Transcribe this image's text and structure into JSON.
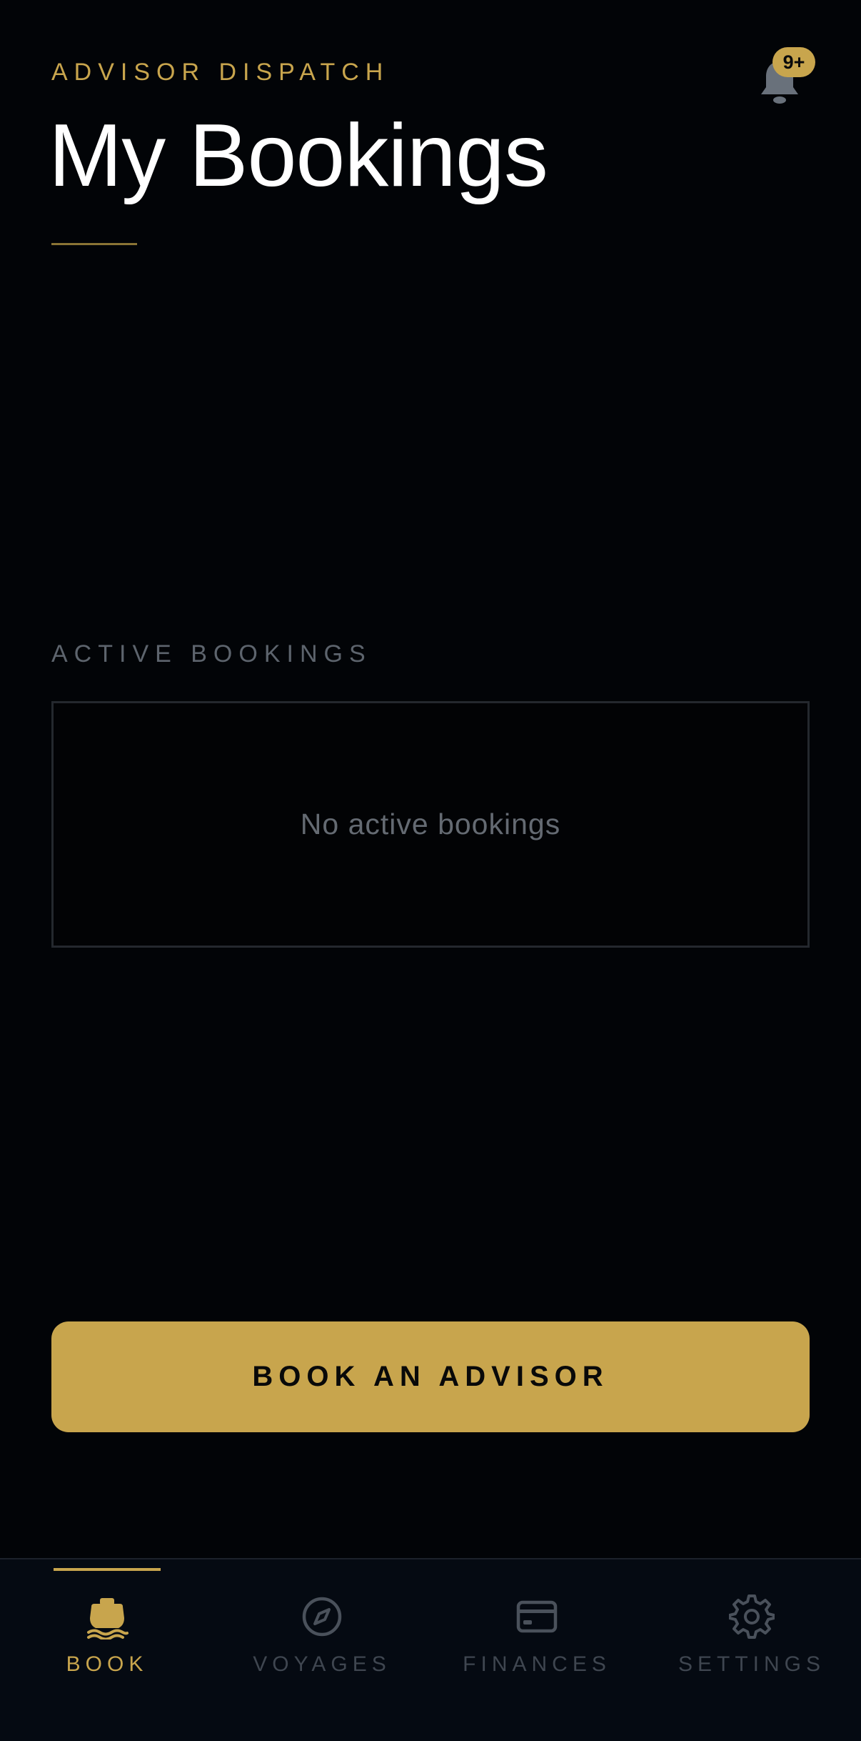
{
  "header": {
    "eyebrow": "ADVISOR DISPATCH",
    "title": "My Bookings",
    "notification_badge": "9+"
  },
  "active_bookings": {
    "section_label": "ACTIVE BOOKINGS",
    "empty_message": "No active bookings"
  },
  "cta": {
    "label": "BOOK AN ADVISOR"
  },
  "tabbar": {
    "tabs": [
      {
        "label": "BOOK",
        "icon": "ship-icon",
        "active": true
      },
      {
        "label": "VOYAGES",
        "icon": "compass-icon",
        "active": false
      },
      {
        "label": "FINANCES",
        "icon": "credit-card-icon",
        "active": false
      },
      {
        "label": "SETTINGS",
        "icon": "gear-icon",
        "active": false
      }
    ]
  },
  "colors": {
    "accent": "#c8a54d",
    "background": "#020407",
    "muted": "#5d646d"
  }
}
